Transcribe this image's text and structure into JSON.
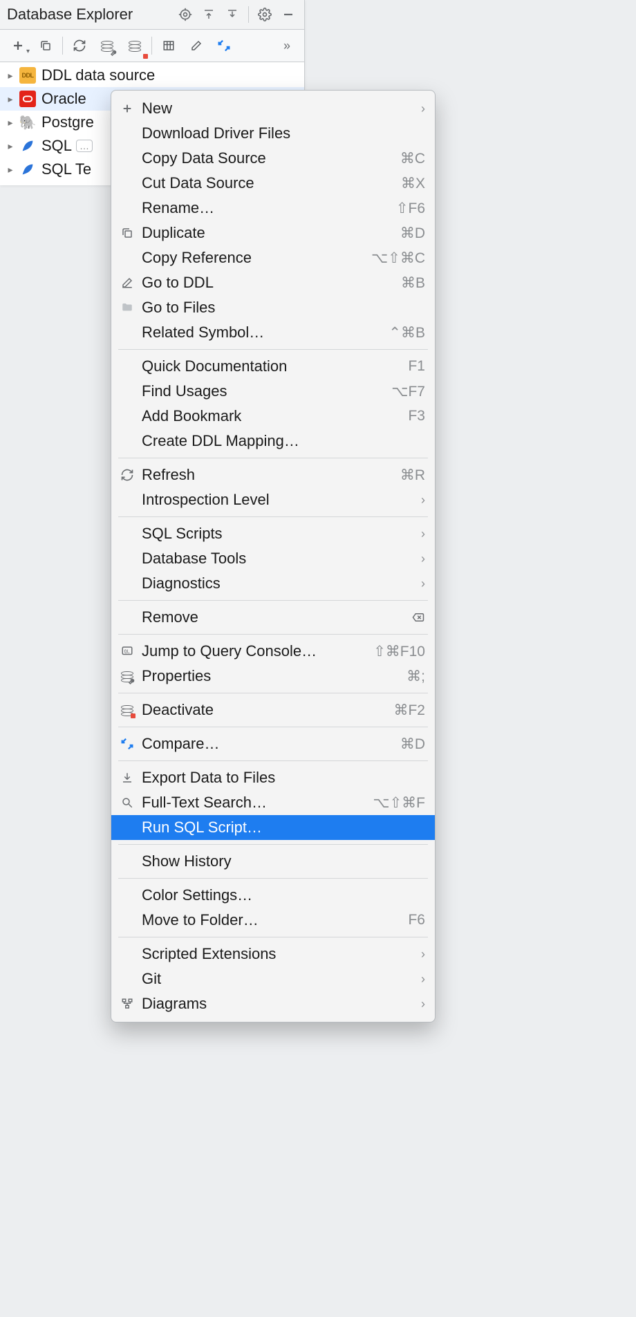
{
  "panel": {
    "title": "Database Explorer",
    "datasources": [
      {
        "label": "DDL data source"
      },
      {
        "label": "Oracle"
      },
      {
        "label": "Postgre"
      },
      {
        "label": "SQL"
      },
      {
        "label": "SQL Te"
      }
    ]
  },
  "menu": [
    {
      "label": "New",
      "icon": "plus",
      "submenu": true
    },
    {
      "label": "Download Driver Files"
    },
    {
      "label": "Copy Data Source",
      "shortcut": "⌘C"
    },
    {
      "label": "Cut Data Source",
      "shortcut": "⌘X"
    },
    {
      "label": "Rename…",
      "shortcut": "⇧F6"
    },
    {
      "label": "Duplicate",
      "icon": "duplicate",
      "shortcut": "⌘D"
    },
    {
      "label": "Copy Reference",
      "shortcut": "⌥⇧⌘C"
    },
    {
      "label": "Go to DDL",
      "icon": "pencil",
      "shortcut": "⌘B"
    },
    {
      "label": "Go to Files",
      "icon": "folder"
    },
    {
      "label": "Related Symbol…",
      "shortcut": "⌃⌘B"
    },
    {
      "sep": true
    },
    {
      "label": "Quick Documentation",
      "shortcut": "F1"
    },
    {
      "label": "Find Usages",
      "shortcut": "⌥F7"
    },
    {
      "label": "Add Bookmark",
      "shortcut": "F3"
    },
    {
      "label": "Create DDL Mapping…"
    },
    {
      "sep": true
    },
    {
      "label": "Refresh",
      "icon": "refresh",
      "shortcut": "⌘R"
    },
    {
      "label": "Introspection Level",
      "submenu": true
    },
    {
      "sep": true
    },
    {
      "label": "SQL Scripts",
      "submenu": true
    },
    {
      "label": "Database Tools",
      "submenu": true
    },
    {
      "label": "Diagnostics",
      "submenu": true
    },
    {
      "sep": true
    },
    {
      "label": "Remove",
      "righticon": "delete"
    },
    {
      "sep": true
    },
    {
      "label": "Jump to Query Console…",
      "icon": "console",
      "shortcut": "⇧⌘F10"
    },
    {
      "label": "Properties",
      "icon": "dbwrench",
      "shortcut": "⌘;"
    },
    {
      "sep": true
    },
    {
      "label": "Deactivate",
      "icon": "dbstop",
      "shortcut": "⌘F2"
    },
    {
      "sep": true
    },
    {
      "label": "Compare…",
      "icon": "compare",
      "shortcut": "⌘D"
    },
    {
      "sep": true
    },
    {
      "label": "Export Data to Files",
      "icon": "export"
    },
    {
      "label": "Full-Text Search…",
      "icon": "search",
      "shortcut": "⌥⇧⌘F"
    },
    {
      "label": "Run SQL Script…",
      "selected": true
    },
    {
      "sep": true
    },
    {
      "label": "Show History"
    },
    {
      "sep": true
    },
    {
      "label": "Color Settings…"
    },
    {
      "label": "Move to Folder…",
      "shortcut": "F6"
    },
    {
      "sep": true
    },
    {
      "label": "Scripted Extensions",
      "submenu": true
    },
    {
      "label": "Git",
      "submenu": true
    },
    {
      "label": "Diagrams",
      "icon": "diagram",
      "submenu": true
    }
  ]
}
